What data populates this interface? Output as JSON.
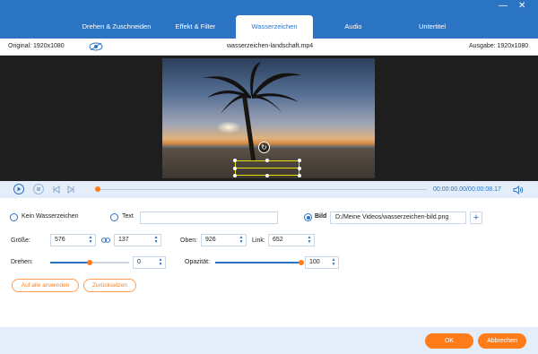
{
  "tabs": [
    {
      "label": "Drehen & Zuschneiden",
      "active": false
    },
    {
      "label": "Effekt & Filter",
      "active": false
    },
    {
      "label": "Wasserzeichen",
      "active": true
    },
    {
      "label": "Audio",
      "active": false
    },
    {
      "label": "Untertitel",
      "active": false
    }
  ],
  "window": {
    "minimize": "—",
    "close": "✕"
  },
  "infobar": {
    "original": "Original: 1920x1080",
    "filename": "wasserzeichen-landschaft.mp4",
    "output": "Ausgabe: 1920x1080"
  },
  "player": {
    "time": "00:00:00.00/00:00:08.17",
    "progress": 0.0
  },
  "watermark": {
    "none_label": "Kein Wasserzeichen",
    "text_label": "Text",
    "text_value": "",
    "image_label": "Bild",
    "image_path": "D:/Meine Videos/wasserzeichen-bild.png",
    "selected": "image",
    "add_button": "+"
  },
  "size": {
    "label": "Größe:",
    "width": "576",
    "height": "137"
  },
  "position": {
    "top_label": "Oben:",
    "top_value": "926",
    "left_label": "Link:",
    "left_value": "652"
  },
  "rotate": {
    "label": "Drehen:",
    "value": "0",
    "slider_fraction": 0.5
  },
  "opacity": {
    "label": "Opazität:",
    "value": "100",
    "slider_fraction": 1.0
  },
  "actions": {
    "apply_all": "Auf alle anwenden",
    "reset": "Zurücksetzen"
  },
  "footer": {
    "ok": "OK",
    "cancel": "Abbrechen"
  },
  "colors": {
    "accent": "#2b74c4",
    "orange": "#ff7c1a",
    "selection": "#e8e200"
  }
}
